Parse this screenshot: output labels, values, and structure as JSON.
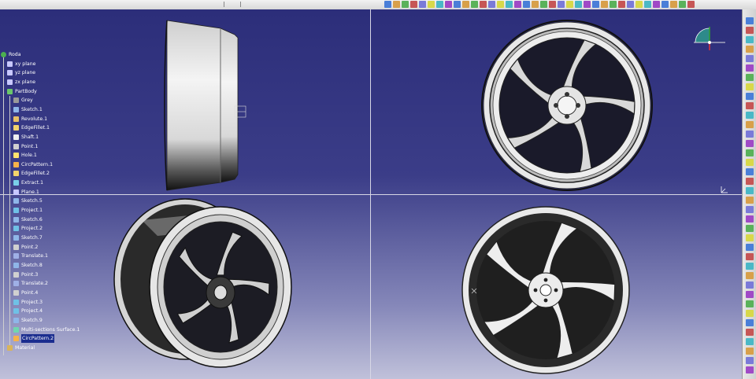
{
  "tree": {
    "root": "Roda",
    "items": [
      {
        "label": "xy plane",
        "icon": "plane-icon",
        "indent": 1
      },
      {
        "label": "yz plane",
        "icon": "plane-icon",
        "indent": 1
      },
      {
        "label": "zx plane",
        "icon": "plane-icon",
        "indent": 1
      },
      {
        "label": "PartBody",
        "icon": "partbody-icon",
        "indent": 1
      },
      {
        "label": "Grey",
        "icon": "material-ball-icon",
        "indent": 2
      },
      {
        "label": "Sketch.1",
        "icon": "sketch-icon",
        "indent": 2
      },
      {
        "label": "Revolute.1",
        "icon": "revolute-icon",
        "indent": 2
      },
      {
        "label": "EdgeFillet.1",
        "icon": "fillet-icon",
        "indent": 2
      },
      {
        "label": "Shaft.1",
        "icon": "shaft-icon",
        "indent": 2
      },
      {
        "label": "Point.1",
        "icon": "point-icon",
        "indent": 2
      },
      {
        "label": "Hole.1",
        "icon": "hole-icon",
        "indent": 2
      },
      {
        "label": "CircPattern.1",
        "icon": "pattern-icon",
        "indent": 2
      },
      {
        "label": "EdgeFillet.2",
        "icon": "fillet-icon",
        "indent": 2
      },
      {
        "label": "Extract.1",
        "icon": "extract-icon",
        "indent": 2
      },
      {
        "label": "Plane.1",
        "icon": "plane-icon",
        "indent": 2
      },
      {
        "label": "Sketch.5",
        "icon": "sketch-icon",
        "indent": 2
      },
      {
        "label": "Project.1",
        "icon": "project-icon",
        "indent": 2
      },
      {
        "label": "Sketch.6",
        "icon": "sketch-icon",
        "indent": 2
      },
      {
        "label": "Project.2",
        "icon": "project-icon",
        "indent": 2
      },
      {
        "label": "Sketch.7",
        "icon": "sketch-icon",
        "indent": 2
      },
      {
        "label": "Point.2",
        "icon": "point-icon",
        "indent": 2
      },
      {
        "label": "Translate.1",
        "icon": "translate-icon",
        "indent": 2
      },
      {
        "label": "Sketch.8",
        "icon": "sketch-icon",
        "indent": 2
      },
      {
        "label": "Point.3",
        "icon": "point-icon",
        "indent": 2
      },
      {
        "label": "Translate.2",
        "icon": "translate-icon",
        "indent": 2
      },
      {
        "label": "Point.4",
        "icon": "point-icon",
        "indent": 2
      },
      {
        "label": "Project.3",
        "icon": "project-icon",
        "indent": 2
      },
      {
        "label": "Project.4",
        "icon": "project-icon",
        "indent": 2
      },
      {
        "label": "Sketch.9",
        "icon": "sketch-icon",
        "indent": 2
      },
      {
        "label": "Multi-sections Surface.1",
        "icon": "multisection-icon",
        "indent": 2
      },
      {
        "label": "CircPattern.2",
        "icon": "pattern-icon",
        "indent": 2,
        "selected": true
      },
      {
        "label": "Material",
        "icon": "material-icon",
        "indent": 1
      }
    ]
  },
  "colors": {
    "bg_top": "#2c2e7a",
    "bg_bottom": "#c0c1da",
    "tree_text": "#ffffff",
    "selection": "#1b2d8f",
    "wheel_light": "#e6e6e6",
    "wheel_dark": "#222222"
  },
  "views": [
    "side-view",
    "front-view",
    "iso-view",
    "rear-view"
  ]
}
